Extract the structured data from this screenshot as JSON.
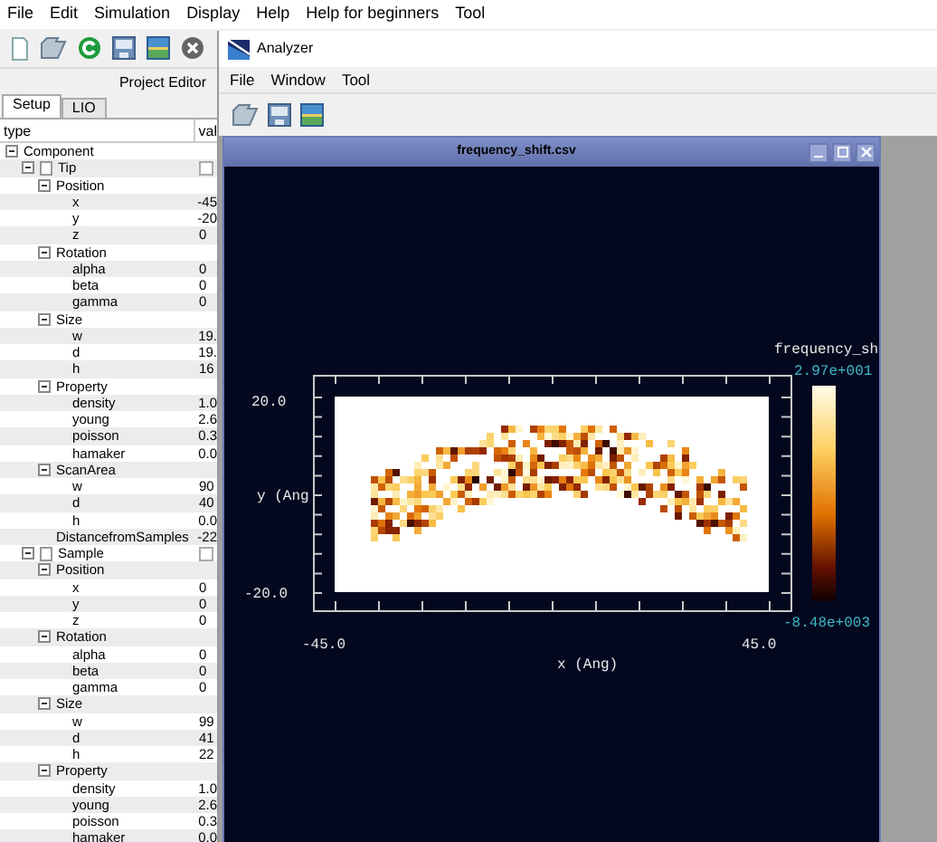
{
  "main_window": {
    "menu": [
      "File",
      "Edit",
      "Simulation",
      "Display",
      "Help",
      "Help for beginners",
      "Tool"
    ],
    "panel_title": "Project Editor",
    "tabs": [
      {
        "label": "Setup",
        "selected": true
      },
      {
        "label": "LIO",
        "selected": false
      }
    ],
    "columns": [
      "type",
      "val"
    ],
    "tree": [
      {
        "label": "Component",
        "kind": "group",
        "expanded": true,
        "children": [
          {
            "label": "Tip",
            "kind": "object",
            "expanded": true,
            "children": [
              {
                "label": "Position",
                "kind": "group",
                "expanded": true,
                "children": [
                  {
                    "label": "x",
                    "kind": "field",
                    "value": "-45"
                  },
                  {
                    "label": "y",
                    "kind": "field",
                    "value": "-20"
                  },
                  {
                    "label": "z",
                    "kind": "field",
                    "value": "0"
                  }
                ]
              },
              {
                "label": "Rotation",
                "kind": "group",
                "expanded": true,
                "children": [
                  {
                    "label": "alpha",
                    "kind": "field",
                    "value": "0"
                  },
                  {
                    "label": "beta",
                    "kind": "field",
                    "value": "0"
                  },
                  {
                    "label": "gamma",
                    "kind": "field",
                    "value": "0"
                  }
                ]
              },
              {
                "label": "Size",
                "kind": "group",
                "expanded": true,
                "children": [
                  {
                    "label": "w",
                    "kind": "field",
                    "value": "19."
                  },
                  {
                    "label": "d",
                    "kind": "field",
                    "value": "19."
                  },
                  {
                    "label": "h",
                    "kind": "field",
                    "value": "16"
                  }
                ]
              },
              {
                "label": "Property",
                "kind": "group",
                "expanded": true,
                "children": [
                  {
                    "label": "density",
                    "kind": "field",
                    "value": "1.0"
                  },
                  {
                    "label": "young",
                    "kind": "field",
                    "value": "2.6"
                  },
                  {
                    "label": "poisson",
                    "kind": "field",
                    "value": "0.3"
                  },
                  {
                    "label": "hamaker",
                    "kind": "field",
                    "value": "0.0"
                  }
                ]
              },
              {
                "label": "ScanArea",
                "kind": "group",
                "expanded": true,
                "children": [
                  {
                    "label": "w",
                    "kind": "field",
                    "value": "90"
                  },
                  {
                    "label": "d",
                    "kind": "field",
                    "value": "40"
                  },
                  {
                    "label": "h",
                    "kind": "field",
                    "value": "0.0"
                  }
                ]
              },
              {
                "label": "DistancefromSamples",
                "kind": "field",
                "value": "-22"
              }
            ]
          },
          {
            "label": "Sample",
            "kind": "object",
            "expanded": true,
            "children": [
              {
                "label": "Position",
                "kind": "group",
                "expanded": true,
                "children": [
                  {
                    "label": "x",
                    "kind": "field",
                    "value": "0"
                  },
                  {
                    "label": "y",
                    "kind": "field",
                    "value": "0"
                  },
                  {
                    "label": "z",
                    "kind": "field",
                    "value": "0"
                  }
                ]
              },
              {
                "label": "Rotation",
                "kind": "group",
                "expanded": true,
                "children": [
                  {
                    "label": "alpha",
                    "kind": "field",
                    "value": "0"
                  },
                  {
                    "label": "beta",
                    "kind": "field",
                    "value": "0"
                  },
                  {
                    "label": "gamma",
                    "kind": "field",
                    "value": "0"
                  }
                ]
              },
              {
                "label": "Size",
                "kind": "group",
                "expanded": true,
                "children": [
                  {
                    "label": "w",
                    "kind": "field",
                    "value": "99"
                  },
                  {
                    "label": "d",
                    "kind": "field",
                    "value": "41"
                  },
                  {
                    "label": "h",
                    "kind": "field",
                    "value": "22"
                  }
                ]
              },
              {
                "label": "Property",
                "kind": "group",
                "expanded": true,
                "children": [
                  {
                    "label": "density",
                    "kind": "field",
                    "value": "1.0"
                  },
                  {
                    "label": "young",
                    "kind": "field",
                    "value": "2.6"
                  },
                  {
                    "label": "poisson",
                    "kind": "field",
                    "value": "0.3"
                  },
                  {
                    "label": "hamaker",
                    "kind": "field",
                    "value": "0.0"
                  }
                ]
              }
            ]
          }
        ]
      }
    ]
  },
  "analyzer": {
    "title": "Analyzer",
    "menu": [
      "File",
      "Window",
      "Tool"
    ],
    "document": {
      "title": "frequency_shift.csv",
      "plot": {
        "colorbar_title": "frequency_sh",
        "colorbar_max": "2.97e+001",
        "colorbar_min": "-8.48e+003",
        "y_ticks": [
          "20.0",
          "-20.0"
        ],
        "ylabel": "y (Ang",
        "x_ticks": [
          "-45.0",
          "45.0"
        ],
        "xlabel": "x (Ang)"
      }
    }
  }
}
